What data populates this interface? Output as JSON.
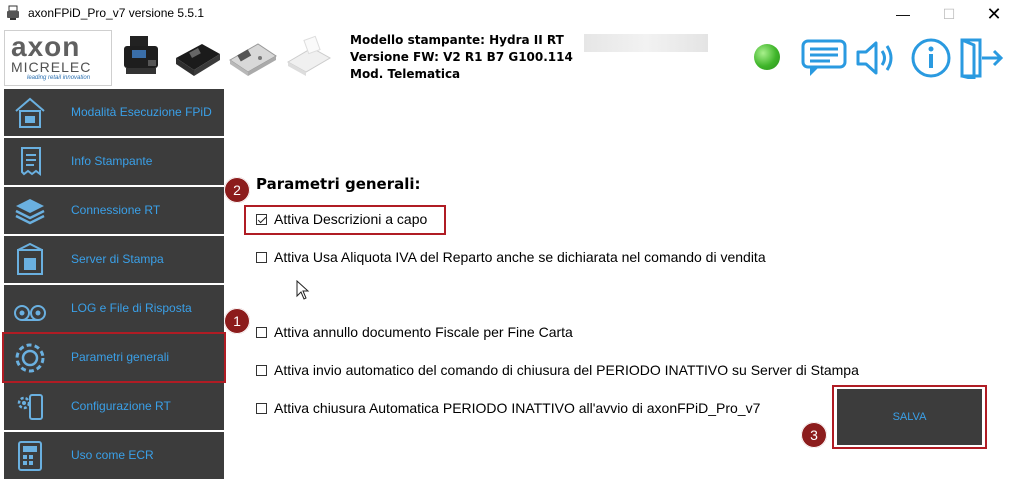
{
  "window": {
    "title": "axonFPiD_Pro_v7 versione 5.5.1",
    "minimize": "—",
    "maximize": "☐",
    "close": "✕"
  },
  "header": {
    "logo": {
      "brand": "axon",
      "sub": "MICRELEC",
      "tagline": "leading retail innovation"
    },
    "model_line": "Modello stampante: Hydra II RT",
    "fw_line": "Versione FW: V2 R1 B7 G100.114",
    "mod_line": "Mod. Telematica",
    "status_color": "#3fb52a",
    "icons": [
      "chat-icon",
      "speaker-icon",
      "info-icon",
      "exit-icon"
    ]
  },
  "sidebar": {
    "items": [
      {
        "label": "Modalità Esecuzione FPiD",
        "icon": "house-printer-icon"
      },
      {
        "label": "Info Stampante",
        "icon": "receipt-icon"
      },
      {
        "label": "Connessione RT",
        "icon": "layers-icon"
      },
      {
        "label": "Server di Stampa",
        "icon": "server-icon"
      },
      {
        "label": "LOG e File di Risposta",
        "icon": "tape-icon"
      },
      {
        "label": "Parametri generali",
        "icon": "gear-icon"
      },
      {
        "label": "Configurazione RT",
        "icon": "gear-device-icon"
      },
      {
        "label": "Uso come ECR",
        "icon": "calculator-icon"
      }
    ],
    "active_index": 5
  },
  "main": {
    "section_title": "Parametri generali:",
    "options": [
      {
        "label": "Attiva Descrizioni a capo",
        "checked": true
      },
      {
        "label": "Attiva Usa Aliquota IVA del Reparto anche se dichiarata nel comando di vendita",
        "checked": false
      },
      {
        "label": "Attiva annullo documento Fiscale per Fine Carta",
        "checked": false
      },
      {
        "label": "Attiva invio automatico del comando di chiusura del PERIODO INATTIVO su Server di Stampa",
        "checked": false
      },
      {
        "label": "Attiva chiusura Automatica PERIODO INATTIVO all'avvio di axonFPiD_Pro_v7",
        "checked": false
      }
    ],
    "save_label": "SALVA"
  },
  "badges": {
    "one": "1",
    "two": "2",
    "three": "3"
  },
  "colors": {
    "accent": "#3aa0e8",
    "sidebar_bg": "#3c3c3c",
    "highlight": "#b01c24",
    "badge": "#8c1c1c"
  }
}
